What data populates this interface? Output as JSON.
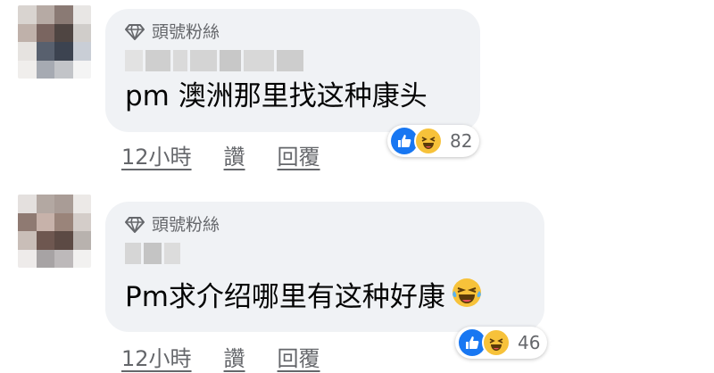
{
  "comments": [
    {
      "badge": "頭號粉絲",
      "text": "pm 澳洲那里找这种康头",
      "emoji_after": "",
      "time": "12小時",
      "like_label": "讚",
      "reply_label": "回覆",
      "reaction_count": "82"
    },
    {
      "badge": "頭號粉絲",
      "text": "Pm求介绍哪里有这种好康",
      "emoji_after": "laughing-crying-emoji",
      "time": "12小時",
      "like_label": "讚",
      "reply_label": "回覆",
      "reaction_count": "46"
    }
  ],
  "colors": {
    "bubble": "#f0f2f5",
    "meta": "#65676b",
    "like_blue": "#1877f2",
    "haha_yellow": "#f7c23a"
  }
}
